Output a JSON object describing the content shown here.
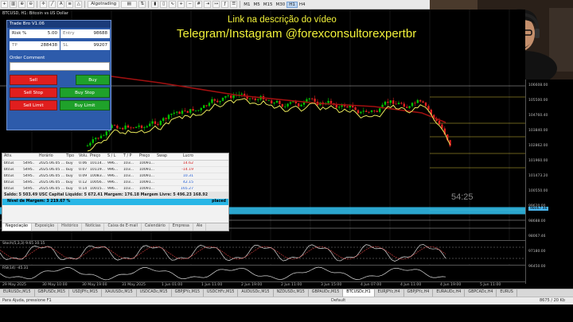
{
  "toolbar": {
    "algotrading_label": "Algotrading",
    "timeframes": [
      "M1",
      "M5",
      "M15",
      "M30",
      "H1",
      "H4"
    ],
    "active_timeframe": "H1"
  },
  "chart": {
    "title": "BTCUSD, H1:  Bitcoin vs US Dollar",
    "overlay_link": "Link na descrição do vídeo",
    "overlay_social": "Telegram/Instagram @forexconsultorexpertbr",
    "countdown": "54:25",
    "price_labels": [
      "106608.00",
      "105500.00",
      "104760.40",
      "103840.00",
      "102862.00",
      "101960.00",
      "101473.20",
      "100550.00",
      "99620.00",
      "98688.00",
      "98067.46",
      "97180.00",
      "96450.00"
    ],
    "live_price": "98067.46",
    "fib_labels": [
      "0.0",
      "23.6",
      "38.2",
      "50.0",
      "61.8",
      "100.0"
    ],
    "colors": {
      "price_up": "#00c000",
      "price_down": "#e02020",
      "ma_slow": "#a01010",
      "ma_fast": "#e8e85a",
      "overlay": "#f2f23a"
    }
  },
  "trade_panel": {
    "title": "Trade Bro V1.06",
    "risk_label": "Risk %",
    "risk_value": "5.00",
    "entry_label": "Entry",
    "entry_value": "98688",
    "tp_label": "TP",
    "tp_value": "288438",
    "sl_label": "SL",
    "sl_value": "99207",
    "order_comment_label": "Order Comment",
    "sell_label": "Sell",
    "buy_label": "Buy",
    "sell_stop_label": "Sell Stop",
    "buy_stop_label": "Buy Stop",
    "sell_limit_label": "Sell Limit",
    "buy_limit_label": "Buy Limit"
  },
  "toolbox": {
    "headers": [
      "Ativ.",
      "",
      "Horário",
      "Tipo",
      "Volu.",
      "Preço",
      "S / L",
      "T / P",
      "Preço",
      "Swap",
      "Lucro"
    ],
    "rows": [
      {
        "symbol": "btcus",
        "id": "5495..",
        "time": "2025.06.05 ...",
        "type": "buy",
        "vol": "0.06",
        "price": "10114...",
        "sl": "996...",
        "tp": "103...",
        "price2": "10091...",
        "swap": "",
        "profit": "14.62",
        "sign": "neg"
      },
      {
        "symbol": "btcus",
        "id": "5495..",
        "time": "2025.06.05 ...",
        "type": "buy",
        "vol": "0.07",
        "price": "10119...",
        "sl": "996...",
        "tp": "103...",
        "price2": "10091...",
        "swap": "",
        "profit": "-14.19",
        "sign": "neg"
      },
      {
        "symbol": "btcus",
        "id": "5495..",
        "time": "2025.06.05 ...",
        "type": "buy",
        "vol": "0.09",
        "price": "10083...",
        "sl": "996...",
        "tp": "103...",
        "price2": "10091...",
        "swap": "",
        "profit": "10.31",
        "sign": "pos"
      },
      {
        "symbol": "btcus",
        "id": "5495..",
        "time": "2025.06.05 ...",
        "type": "buy",
        "vol": "0.12",
        "price": "10056...",
        "sl": "996...",
        "tp": "103...",
        "price2": "10091...",
        "swap": "",
        "profit": "42.15",
        "sign": "pos"
      },
      {
        "symbol": "btcus",
        "id": "5495..",
        "time": "2025.06.05 ...",
        "type": "buy",
        "vol": "0.14",
        "price": "10015...",
        "sl": "996...",
        "tp": "103...",
        "price2": "10091...",
        "swap": "",
        "profit": "165.27",
        "sign": "pos"
      }
    ],
    "balance_text": "Saldo: 5 503.49 USC  Capital Líquido: 5 672.41  Margem: 176.18  Margem Livre: 5 496.23  168.92",
    "margin_text": "Nível de Margem: 3 219.67 %",
    "placed_text": "placed",
    "tabs": [
      "Negociação",
      "Exposição",
      "Histórico",
      "Notícias",
      "Caixa de E-mail",
      "Calendário",
      "Empresa",
      "Ale"
    ],
    "active_tab": "Negociação"
  },
  "indicators": {
    "stoch_label": "Stoch(5,3,3) 9.65 10.15",
    "rsi_label": "RSI(14) -45.31"
  },
  "time_axis": [
    "29 May 2025",
    "30 May 10:00",
    "30 May 19:00",
    "31 May 2025",
    "1 Jun 01:00",
    "1 Jun 11:00",
    "2 Jun 19:00",
    "2 Jun 11:00",
    "3 Jun 15:00",
    "4 Jun 07:00",
    "4 Jun 11:00",
    "4 Jun 19:00",
    "5 Jun 11:00"
  ],
  "symbol_tabs": [
    "EURUSDc,M15",
    "GBPUSDc,M15",
    "USDJPYc,M15",
    "XAUUSDc,M15",
    "USDCADc,M15",
    "GBPJPYc,M15",
    "USDCHFc,M15",
    "AUDUSDc,M15",
    "NZDUSDc,M15",
    "GBPAUDc,M15",
    "BTCUSDc,H1",
    "EURJPYc,H4",
    "GBPJPYc,H4",
    "EURAUDc,H4",
    "GBPCADc,H4",
    "EURUS"
  ],
  "active_symbol": "BTCUSDc,H1",
  "status_bar": {
    "help_text": "Para Ajuda, pressione F1",
    "profile": "Default",
    "traffic": "8675 / 20 Kb"
  }
}
